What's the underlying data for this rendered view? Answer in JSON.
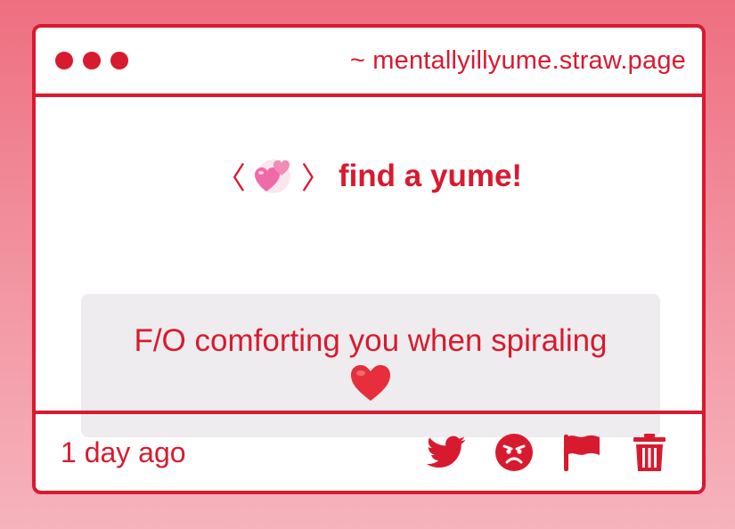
{
  "colors": {
    "accent": "#d81a2f",
    "card_background": "#eeecee",
    "window_background": "#ffffff"
  },
  "titlebar": {
    "url": "~ mentallyillyume.straw.page"
  },
  "heading": {
    "left_bracket": "〈",
    "right_bracket": "〉",
    "emoji": "two-hearts-icon",
    "text": "find a yume!"
  },
  "card": {
    "text": "F/O comforting you when spiraling",
    "emoji": "red-heart-icon"
  },
  "footer": {
    "timestamp": "1 day ago",
    "actions": [
      "twitter-icon",
      "angry-face-icon",
      "flag-icon",
      "trash-icon"
    ]
  }
}
